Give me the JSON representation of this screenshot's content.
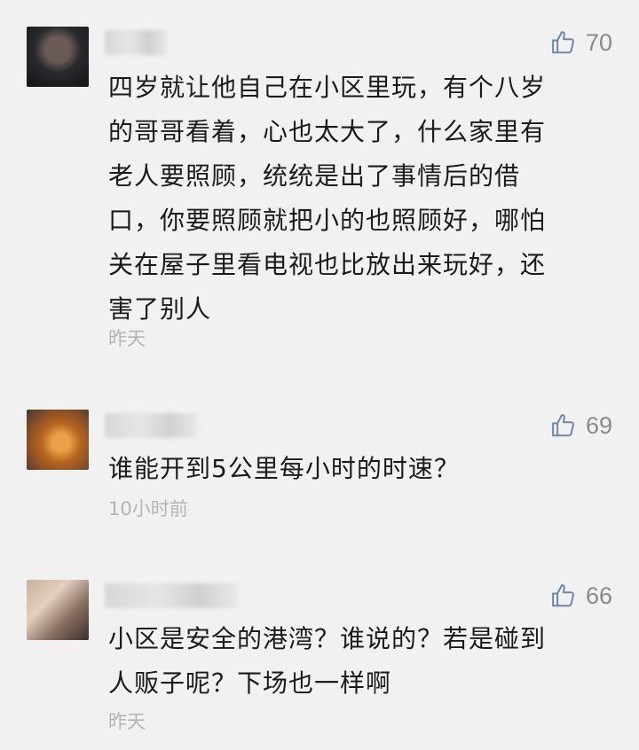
{
  "comments": [
    {
      "likes": "70",
      "text": "四岁就让他自己在小区里玩，有个八岁\n的哥哥看着，心也太大了，什么家里有\n老人要照顾，统统是出了事情后的借\n口，你要照顾就把小的也照顾好，哪怕\n关在屋子里看电视也比放出来玩好，还\n害了别人",
      "time": "昨天"
    },
    {
      "likes": "69",
      "text": "谁能开到5公里每小时的时速？",
      "time": "10小时前"
    },
    {
      "likes": "66",
      "text": "小区是安全的港湾？谁说的？若是碰到\n人贩子呢？下场也一样啊",
      "time": "昨天"
    }
  ],
  "icons": {
    "like": "thumbs-up-icon"
  },
  "colors": {
    "background": "#f1f1f1",
    "text": "#1b1b1b",
    "meta": "#8a8a8a",
    "time": "#b4b4b4"
  }
}
